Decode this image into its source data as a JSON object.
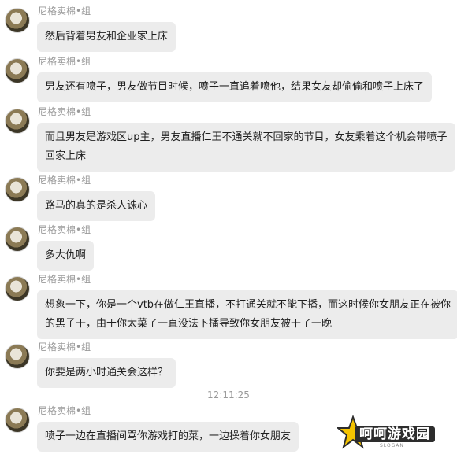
{
  "messages": [
    {
      "sender": "尼格卖棉•组",
      "lines": [
        "然后背着男友和企业家上床"
      ]
    },
    {
      "sender": "尼格卖棉•组",
      "lines": [
        "男友还有喷子，男友做节目时候，喷子一直追着喷他，结果女友却偷偷和喷子上床了"
      ]
    },
    {
      "sender": "尼格卖棉•组",
      "lines": [
        "而且男友是游戏区up主，男友直播仁王不通关就不回家的节目，女友乘着这个机会带喷子",
        "回家上床"
      ]
    },
    {
      "sender": "尼格卖棉•组",
      "lines": [
        "路马的真的是杀人诛心"
      ]
    },
    {
      "sender": "尼格卖棉•组",
      "lines": [
        "多大仇啊"
      ]
    },
    {
      "sender": "尼格卖棉•组",
      "lines": [
        "想象一下，你是一个vtb在做仁王直播，不打通关就不能下播，而这时候你女朋友正在被你",
        "的黑子干，由于你太菜了一直没法下播导致你女朋友被干了一晚"
      ]
    },
    {
      "sender": "尼格卖棉•组",
      "lines": [
        "你要是两小时通关会这样？"
      ]
    },
    {
      "sender": "尼格卖棉•组",
      "lines": [
        "喷子一边在直播间骂你游戏打的菜，一边操着你女朋友"
      ]
    }
  ],
  "timestamp": "12:11:25",
  "watermark": {
    "title": "呵呵游戏园",
    "slogan": "SLOGAN"
  }
}
